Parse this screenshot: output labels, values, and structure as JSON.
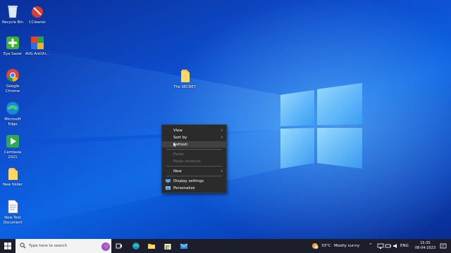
{
  "desktop": {
    "icons": [
      {
        "label": "Recycle Bin",
        "icon": "recycle-bin-icon"
      },
      {
        "label": "CCleaner",
        "icon": "ccleaner-icon"
      },
      {
        "label": "Eye Saver",
        "icon": "eye-saver-icon"
      },
      {
        "label": "AVG AntiVir...",
        "icon": "avg-antivirus-icon"
      },
      {
        "label": "Google Chrome",
        "icon": "chrome-icon"
      },
      {
        "label": "Microsoft Edge",
        "icon": "edge-icon"
      },
      {
        "label": "Camtasia 2021",
        "icon": "camtasia-icon"
      },
      {
        "label": "New folder",
        "icon": "folder-icon"
      },
      {
        "label": "New Text Document",
        "icon": "text-document-icon"
      },
      {
        "label": "The SECRET",
        "icon": "folder-icon"
      }
    ]
  },
  "context_menu": {
    "items": [
      {
        "label": "View",
        "submenu": true,
        "enabled": true
      },
      {
        "label": "Sort by",
        "submenu": true,
        "enabled": true
      },
      {
        "label": "Refresh",
        "submenu": false,
        "enabled": true,
        "hovered": true
      },
      {
        "label": "Paste",
        "submenu": false,
        "enabled": false
      },
      {
        "label": "Paste shortcut",
        "submenu": false,
        "enabled": false
      },
      {
        "label": "New",
        "submenu": true,
        "enabled": true
      },
      {
        "label": "Display settings",
        "submenu": false,
        "enabled": true,
        "icon": "display-settings-icon"
      },
      {
        "label": "Personalize",
        "submenu": false,
        "enabled": true,
        "icon": "personalize-icon"
      }
    ]
  },
  "taskbar": {
    "search_placeholder": "Type here to search",
    "apps": [
      "task-view-icon",
      "edge-icon",
      "file-explorer-icon",
      "store-icon",
      "mail-icon"
    ],
    "weather": {
      "temp": "33°C",
      "condition": "Mostly sunny"
    },
    "language": "ENG",
    "time": "15:35",
    "date": "06-04-2023"
  },
  "colors": {
    "menu_bg": "#2b2b2b",
    "taskbar_bg": "#1c1f2b",
    "desktop_blue": "#0b63e4"
  }
}
